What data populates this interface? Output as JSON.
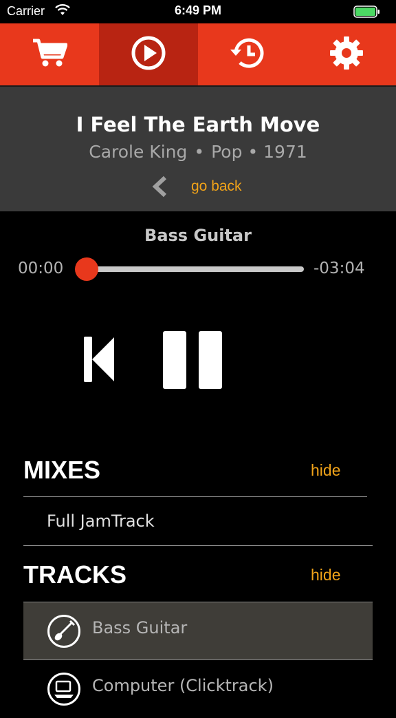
{
  "status_bar": {
    "carrier": "Carrier",
    "time": "6:49 PM",
    "battery_color": "#4cd964"
  },
  "toolbar": {
    "accent": "#e8381c",
    "active_bg": "#b82412",
    "items": [
      {
        "icon": "cart-icon",
        "active": false
      },
      {
        "icon": "play-circle-icon",
        "active": true
      },
      {
        "icon": "history-icon",
        "active": false
      },
      {
        "icon": "gear-icon",
        "active": false
      }
    ]
  },
  "song": {
    "title": "I Feel The Earth Move",
    "artist": "Carole King",
    "separator": "•",
    "genre": "Pop",
    "year": "1971",
    "back_label": "go back"
  },
  "player": {
    "current_track": "Bass Guitar",
    "elapsed": "00:00",
    "remaining": "-03:04",
    "progress": 0
  },
  "mixes": {
    "heading": "MIXES",
    "hide_label": "hide",
    "items": [
      "Full JamTrack"
    ]
  },
  "tracks": {
    "heading": "TRACKS",
    "hide_label": "hide",
    "items": [
      {
        "label": "Bass Guitar",
        "icon": "bass-guitar-icon",
        "selected": true
      },
      {
        "label": "Computer (Clicktrack)",
        "icon": "computer-icon",
        "selected": false
      }
    ]
  }
}
